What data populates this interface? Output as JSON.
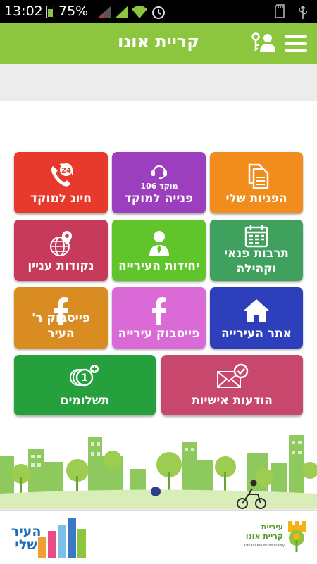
{
  "status": {
    "time": "13:02",
    "battery": "75%"
  },
  "header": {
    "title": "קריית אונו"
  },
  "tiles": [
    {
      "label": "חיוג למוקד",
      "color": "#e8392d",
      "icon": "phone-24-icon",
      "icon_text": "24"
    },
    {
      "label": "פנייה למוקד",
      "color": "#9b3fbf",
      "icon": "headset-icon",
      "icon_text": "מוקד 106"
    },
    {
      "label": "הפניות שלי",
      "color": "#f08d1c",
      "icon": "documents-icon"
    },
    {
      "label": "נקודות עניין",
      "color": "#c83a5b",
      "icon": "globe-pin-icon"
    },
    {
      "label": "יחידות העירייה",
      "color": "#5fc52b",
      "icon": "person-icon"
    },
    {
      "label": "תרבות פנאי וקהילה",
      "color": "#3fa15d",
      "icon": "calendar-icon"
    },
    {
      "label": "פייסבוק ר' העיר",
      "color": "#d98c22",
      "icon": "facebook-icon"
    },
    {
      "label": "פייסבוק עירייה",
      "color": "#d96ad6",
      "icon": "facebook-icon"
    },
    {
      "label": "אתר העירייה",
      "color": "#2e3fbb",
      "icon": "home-icon"
    },
    {
      "label": "תשלומים",
      "color": "#25a03c",
      "icon": "coins-icon",
      "icon_text": "1"
    },
    {
      "label": "הודעות אישיות",
      "color": "#c8486d",
      "icon": "mail-check-icon"
    }
  ],
  "footer": {
    "left_logo": "העיר שלי",
    "right_logo": "עיריית קריית אונו",
    "right_logo_sub": "Kiryat Ono Municipality"
  }
}
